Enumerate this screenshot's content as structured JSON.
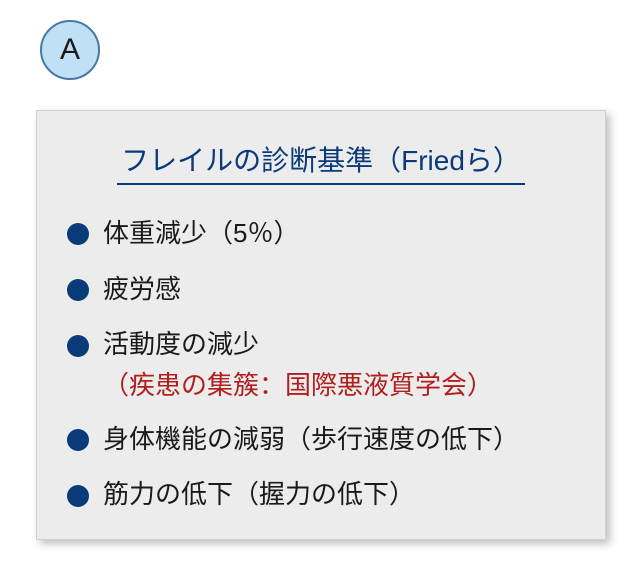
{
  "badge": {
    "label": "A"
  },
  "card": {
    "title": "フレイルの診断基準（Friedら）",
    "items": [
      {
        "text": "体重減少（5％）"
      },
      {
        "text": "疲労感"
      },
      {
        "text": "活動度の減少",
        "sub": "（疾患の集簇：国際悪液質学会）"
      },
      {
        "text": "身体機能の減弱（歩行速度の低下）"
      },
      {
        "text": "筋力の低下（握力の低下）"
      }
    ]
  }
}
